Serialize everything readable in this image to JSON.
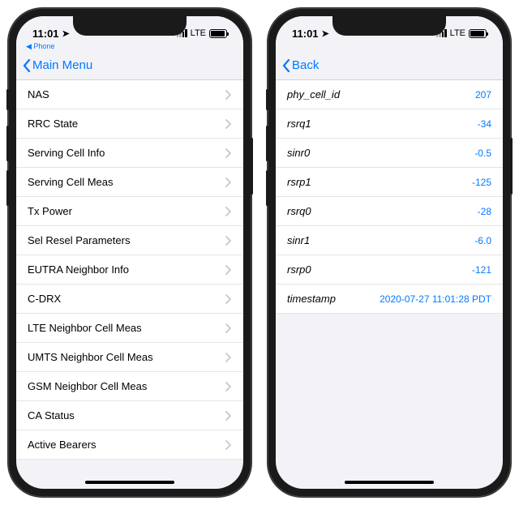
{
  "status": {
    "time": "11:01",
    "network_label": "LTE",
    "breadcrumb_app": "Phone"
  },
  "left_phone": {
    "back_label": "Main Menu",
    "items": [
      {
        "label": "NAS"
      },
      {
        "label": "RRC State"
      },
      {
        "label": "Serving Cell Info"
      },
      {
        "label": "Serving Cell Meas"
      },
      {
        "label": "Tx Power"
      },
      {
        "label": "Sel Resel Parameters"
      },
      {
        "label": "EUTRA Neighbor Info"
      },
      {
        "label": "C-DRX"
      },
      {
        "label": "LTE Neighbor Cell Meas"
      },
      {
        "label": "UMTS Neighbor Cell Meas"
      },
      {
        "label": "GSM Neighbor Cell Meas"
      },
      {
        "label": "CA Status"
      },
      {
        "label": "Active Bearers"
      }
    ]
  },
  "right_phone": {
    "back_label": "Back",
    "items": [
      {
        "label": "phy_cell_id",
        "value": "207"
      },
      {
        "label": "rsrq1",
        "value": "-34"
      },
      {
        "label": "sinr0",
        "value": "-0.5"
      },
      {
        "label": "rsrp1",
        "value": "-125"
      },
      {
        "label": "rsrq0",
        "value": "-28"
      },
      {
        "label": "sinr1",
        "value": "-6.0"
      },
      {
        "label": "rsrp0",
        "value": "-121"
      },
      {
        "label": "timestamp",
        "value": "2020-07-27 11:01:28 PDT"
      }
    ]
  }
}
